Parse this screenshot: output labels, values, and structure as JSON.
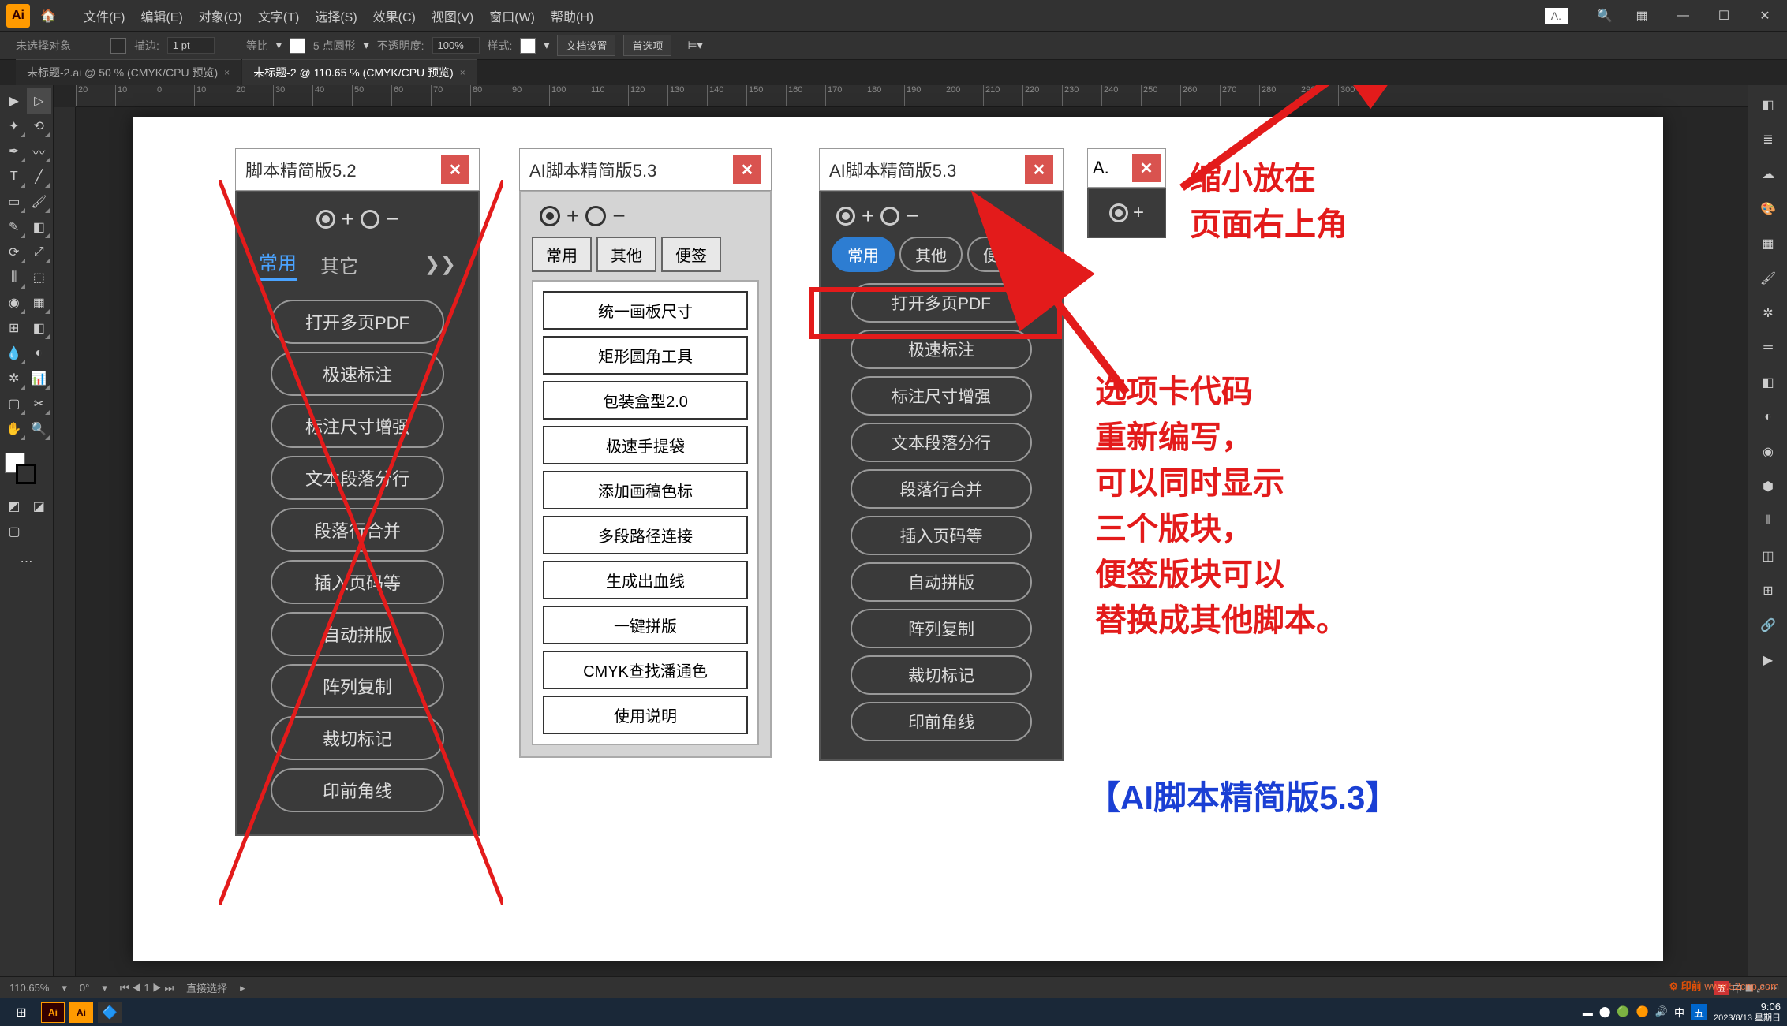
{
  "menubar": {
    "items": [
      "文件(F)",
      "编辑(E)",
      "对象(O)",
      "文字(T)",
      "选择(S)",
      "效果(C)",
      "视图(V)",
      "窗口(W)",
      "帮助(H)"
    ],
    "small_panel_hint": "A."
  },
  "options": {
    "no_selection": "未选择对象",
    "stroke_label": "描边:",
    "stroke_value": "1 pt",
    "uniform": "等比",
    "brush": "5 点圆形",
    "opacity_label": "不透明度:",
    "opacity_value": "100%",
    "style_label": "样式:",
    "doc_setup": "文档设置",
    "preferences": "首选项"
  },
  "tabs": [
    {
      "name": "未标题-2.ai @ 50 % (CMYK/CPU 预览)",
      "active": false
    },
    {
      "name": "未标题-2 @ 110.65 % (CMYK/CPU 预览)",
      "active": true
    }
  ],
  "ruler_ticks": [
    "20",
    "10",
    "0",
    "10",
    "20",
    "30",
    "40",
    "50",
    "60",
    "70",
    "80",
    "90",
    "100",
    "110",
    "120",
    "130",
    "140",
    "150",
    "160",
    "170",
    "180",
    "190",
    "200",
    "210",
    "220",
    "230",
    "240",
    "250",
    "260",
    "270",
    "280",
    "290",
    "300"
  ],
  "status": {
    "zoom": "110.65%",
    "rotate": "0°",
    "artboard": "1",
    "tool": "直接选择"
  },
  "taskbar": {
    "time": "9:06",
    "date": "2023/8/13 星期日"
  },
  "panel1": {
    "title": "脚本精简版5.2",
    "tabs": [
      "常用",
      "其它"
    ],
    "buttons": [
      "打开多页PDF",
      "极速标注",
      "标注尺寸增强",
      "文本段落分行",
      "段落行合并",
      "插入页码等",
      "自动拼版",
      "阵列复制",
      "裁切标记",
      "印前角线"
    ]
  },
  "panel2": {
    "title": "AI脚本精简版5.3",
    "tabs": [
      "常用",
      "其他",
      "便签"
    ],
    "buttons": [
      "统一画板尺寸",
      "矩形圆角工具",
      "包装盒型2.0",
      "极速手提袋",
      "添加画稿色标",
      "多段路径连接",
      "生成出血线",
      "一键拼版",
      "CMYK查找潘通色",
      "使用说明"
    ]
  },
  "panel3": {
    "title": "AI脚本精简版5.3",
    "tabs": [
      "常用",
      "其他",
      "便签"
    ],
    "buttons": [
      "打开多页PDF",
      "极速标注",
      "标注尺寸增强",
      "文本段落分行",
      "段落行合并",
      "插入页码等",
      "自动拼版",
      "阵列复制",
      "裁切标记",
      "印前角线"
    ]
  },
  "panel_mini": {
    "title": "A."
  },
  "annotations": {
    "top1": "缩小放在",
    "top2": "页面右上角",
    "body": "选项卡代码\n重新编写，\n可以同时显示\n三个版块，\n便签版块可以\n替换成其他脚本。",
    "blue": "【AI脚本精简版5.3】"
  },
  "watermark": "www.52cnp.com"
}
